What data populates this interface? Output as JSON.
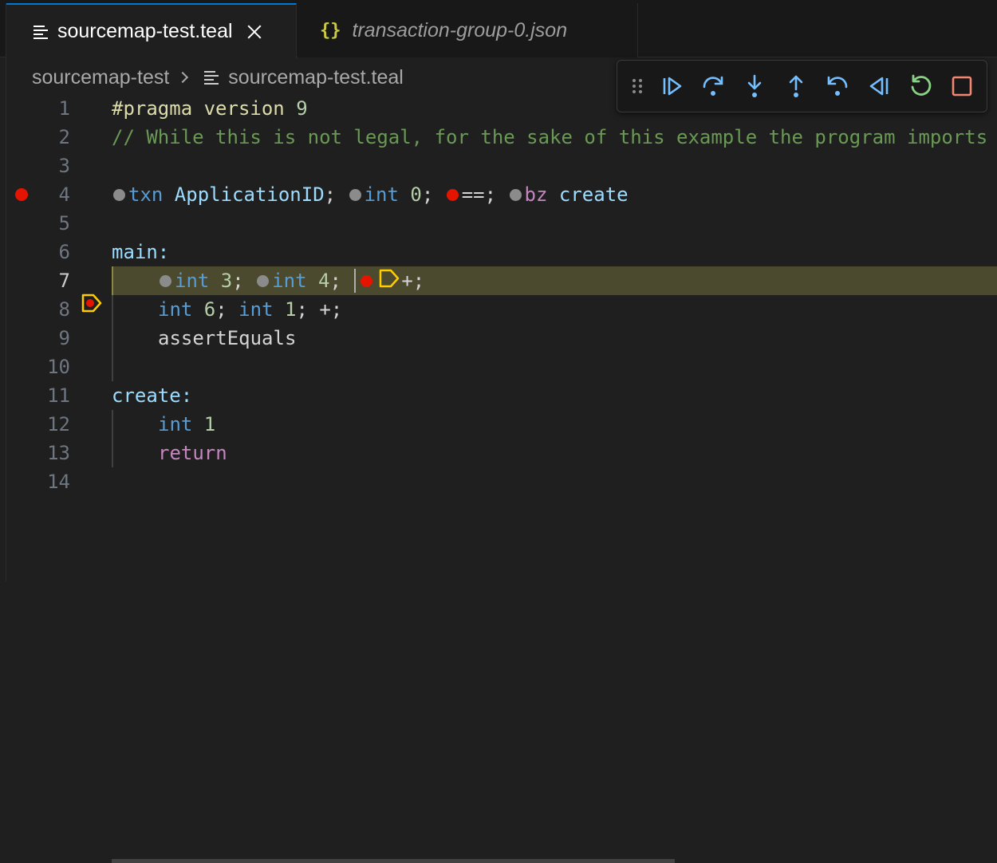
{
  "tabs": [
    {
      "label": "sourcemap-test.teal",
      "active": true,
      "icon": "lines-file-icon"
    },
    {
      "label": "transaction-group-0.json",
      "active": false,
      "icon": "braces-json-icon"
    }
  ],
  "breadcrumb": {
    "folder": "sourcemap-test",
    "file": "sourcemap-test.teal"
  },
  "debug_toolbar": {
    "buttons": [
      {
        "name": "drag-handle-icon",
        "color": "#8b8b8b"
      },
      {
        "name": "continue-icon",
        "color": "#75beff"
      },
      {
        "name": "step-over-icon",
        "color": "#75beff"
      },
      {
        "name": "step-into-icon",
        "color": "#75beff"
      },
      {
        "name": "step-out-icon",
        "color": "#75beff"
      },
      {
        "name": "step-back-icon",
        "color": "#75beff"
      },
      {
        "name": "reverse-continue-icon",
        "color": "#75beff"
      },
      {
        "name": "restart-icon",
        "color": "#89d185"
      },
      {
        "name": "stop-icon",
        "color": "#f48771"
      }
    ]
  },
  "editor": {
    "current_line": 7,
    "lines": [
      {
        "n": "1"
      },
      {
        "n": "2"
      },
      {
        "n": "3"
      },
      {
        "n": "4"
      },
      {
        "n": "5"
      },
      {
        "n": "6"
      },
      {
        "n": "7"
      },
      {
        "n": "8"
      },
      {
        "n": "9"
      },
      {
        "n": "10"
      },
      {
        "n": "11"
      },
      {
        "n": "12"
      },
      {
        "n": "13"
      },
      {
        "n": "14"
      }
    ],
    "code": {
      "l1_a": "#pragma version",
      "l1_b": " 9",
      "l2": "// While this is not legal, for the sake of this example the program imports",
      "l4_txn": "txn",
      "l4_appid": " ApplicationID",
      "l4_semi1": "; ",
      "l4_int": "int",
      "l4_zero": " 0",
      "l4_semi2": "; ",
      "l4_eq": "==;",
      "l4_sp": " ",
      "l4_bz": "bz",
      "l4_create": " create",
      "l6": "main:",
      "l7_int1": "int",
      "l7_3": " 3",
      "l7_semi1": "; ",
      "l7_int2": "int",
      "l7_4": " 4",
      "l7_semi2": "; ",
      "l7_plus": "+;",
      "l8_int1": "int",
      "l8_6": " 6",
      "l8_semi1": "; ",
      "l8_int2": "int",
      "l8_1": " 1",
      "l8_rest": "; +;",
      "l9": "assertEquals",
      "l11": "create:",
      "l12_int": "int",
      "l12_1": " 1",
      "l13": "return"
    }
  },
  "colors": {
    "breakpoint": "#e51400",
    "current_line_marker": "#ffcc00",
    "accent": "#0078d4"
  }
}
